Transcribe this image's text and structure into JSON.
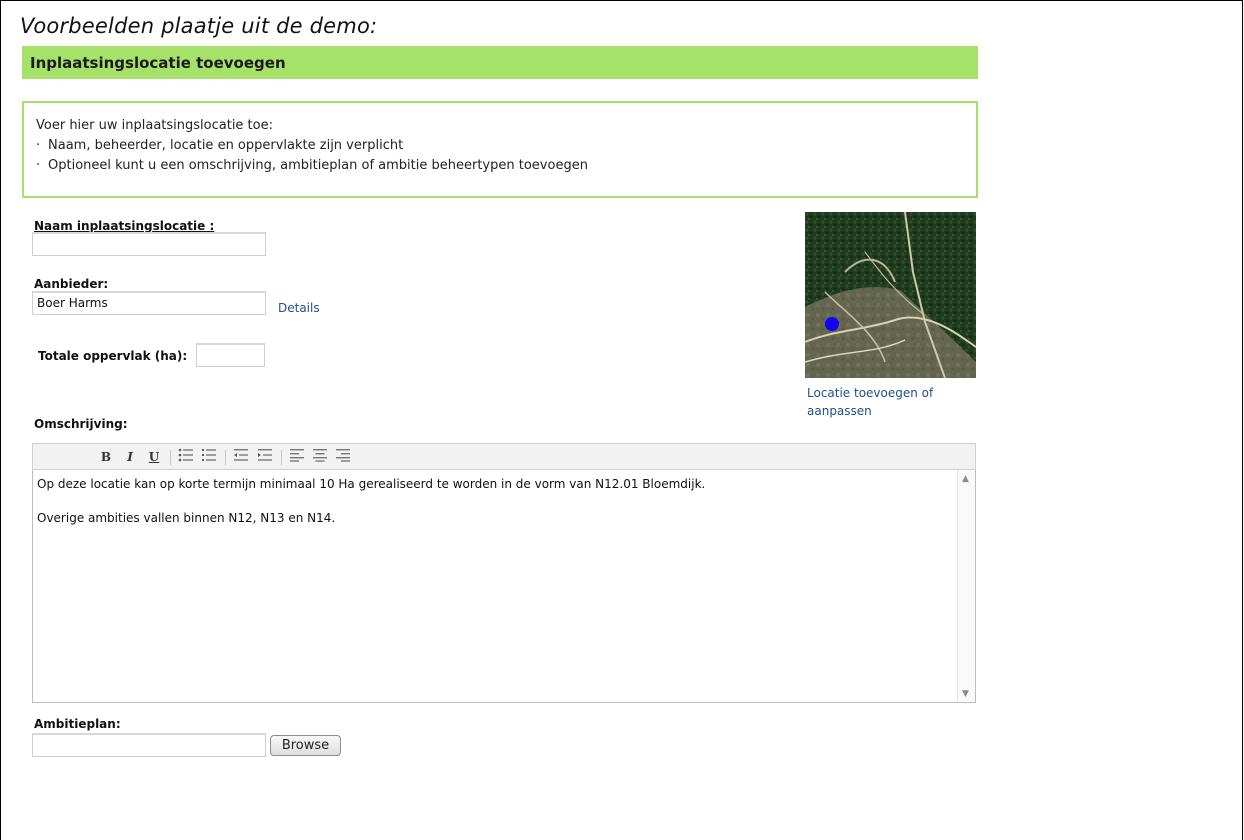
{
  "caption": "Voorbeelden plaatje uit de demo:",
  "header": {
    "title": "Inplaatsingslocatie toevoegen"
  },
  "info": {
    "intro": "Voer hier uw inplaatsingslocatie toe:",
    "bullets": [
      "Naam, beheerder, locatie en oppervlakte zijn verplicht",
      "Optioneel kunt u een omschrijving, ambitieplan of ambitie beheertypen toevoegen"
    ]
  },
  "form": {
    "name_label": "Naam inplaatsingslocatie :",
    "name_value": "",
    "provider_label": "Aanbieder:",
    "provider_value": "Boer Harms",
    "details_link": "Details",
    "area_label": "Totale oppervlak (ha):",
    "area_value": "",
    "description_label": "Omschrijving:",
    "description_paragraphs": [
      "Op deze locatie kan op korte termijn minimaal 10 Ha gerealiseerd te worden in de vorm van N12.01 Bloemdijk.",
      "Overige ambities vallen binnen N12, N13 en N14."
    ],
    "ambition_label": "Ambitieplan:",
    "ambition_value": "",
    "browse_label": "Browse"
  },
  "map": {
    "link": "Locatie toevoegen of aanpassen",
    "marker_color": "#1500ff"
  },
  "toolbar": {
    "buttons": [
      {
        "name": "bold-button",
        "label": "B"
      },
      {
        "name": "italic-button",
        "label": "I"
      },
      {
        "name": "underline-button",
        "label": "U"
      },
      {
        "name": "bullet-list-button",
        "icon": "bullet-list-icon"
      },
      {
        "name": "numbered-list-button",
        "icon": "numbered-list-icon"
      },
      {
        "name": "outdent-button",
        "icon": "outdent-icon"
      },
      {
        "name": "indent-button",
        "icon": "indent-icon"
      },
      {
        "name": "align-left-button",
        "icon": "align-left-icon"
      },
      {
        "name": "align-center-button",
        "icon": "align-center-icon"
      },
      {
        "name": "align-right-button",
        "icon": "align-right-icon"
      }
    ]
  },
  "colors": {
    "accent_green": "#a6e26a",
    "link_blue": "#1f4f86"
  }
}
